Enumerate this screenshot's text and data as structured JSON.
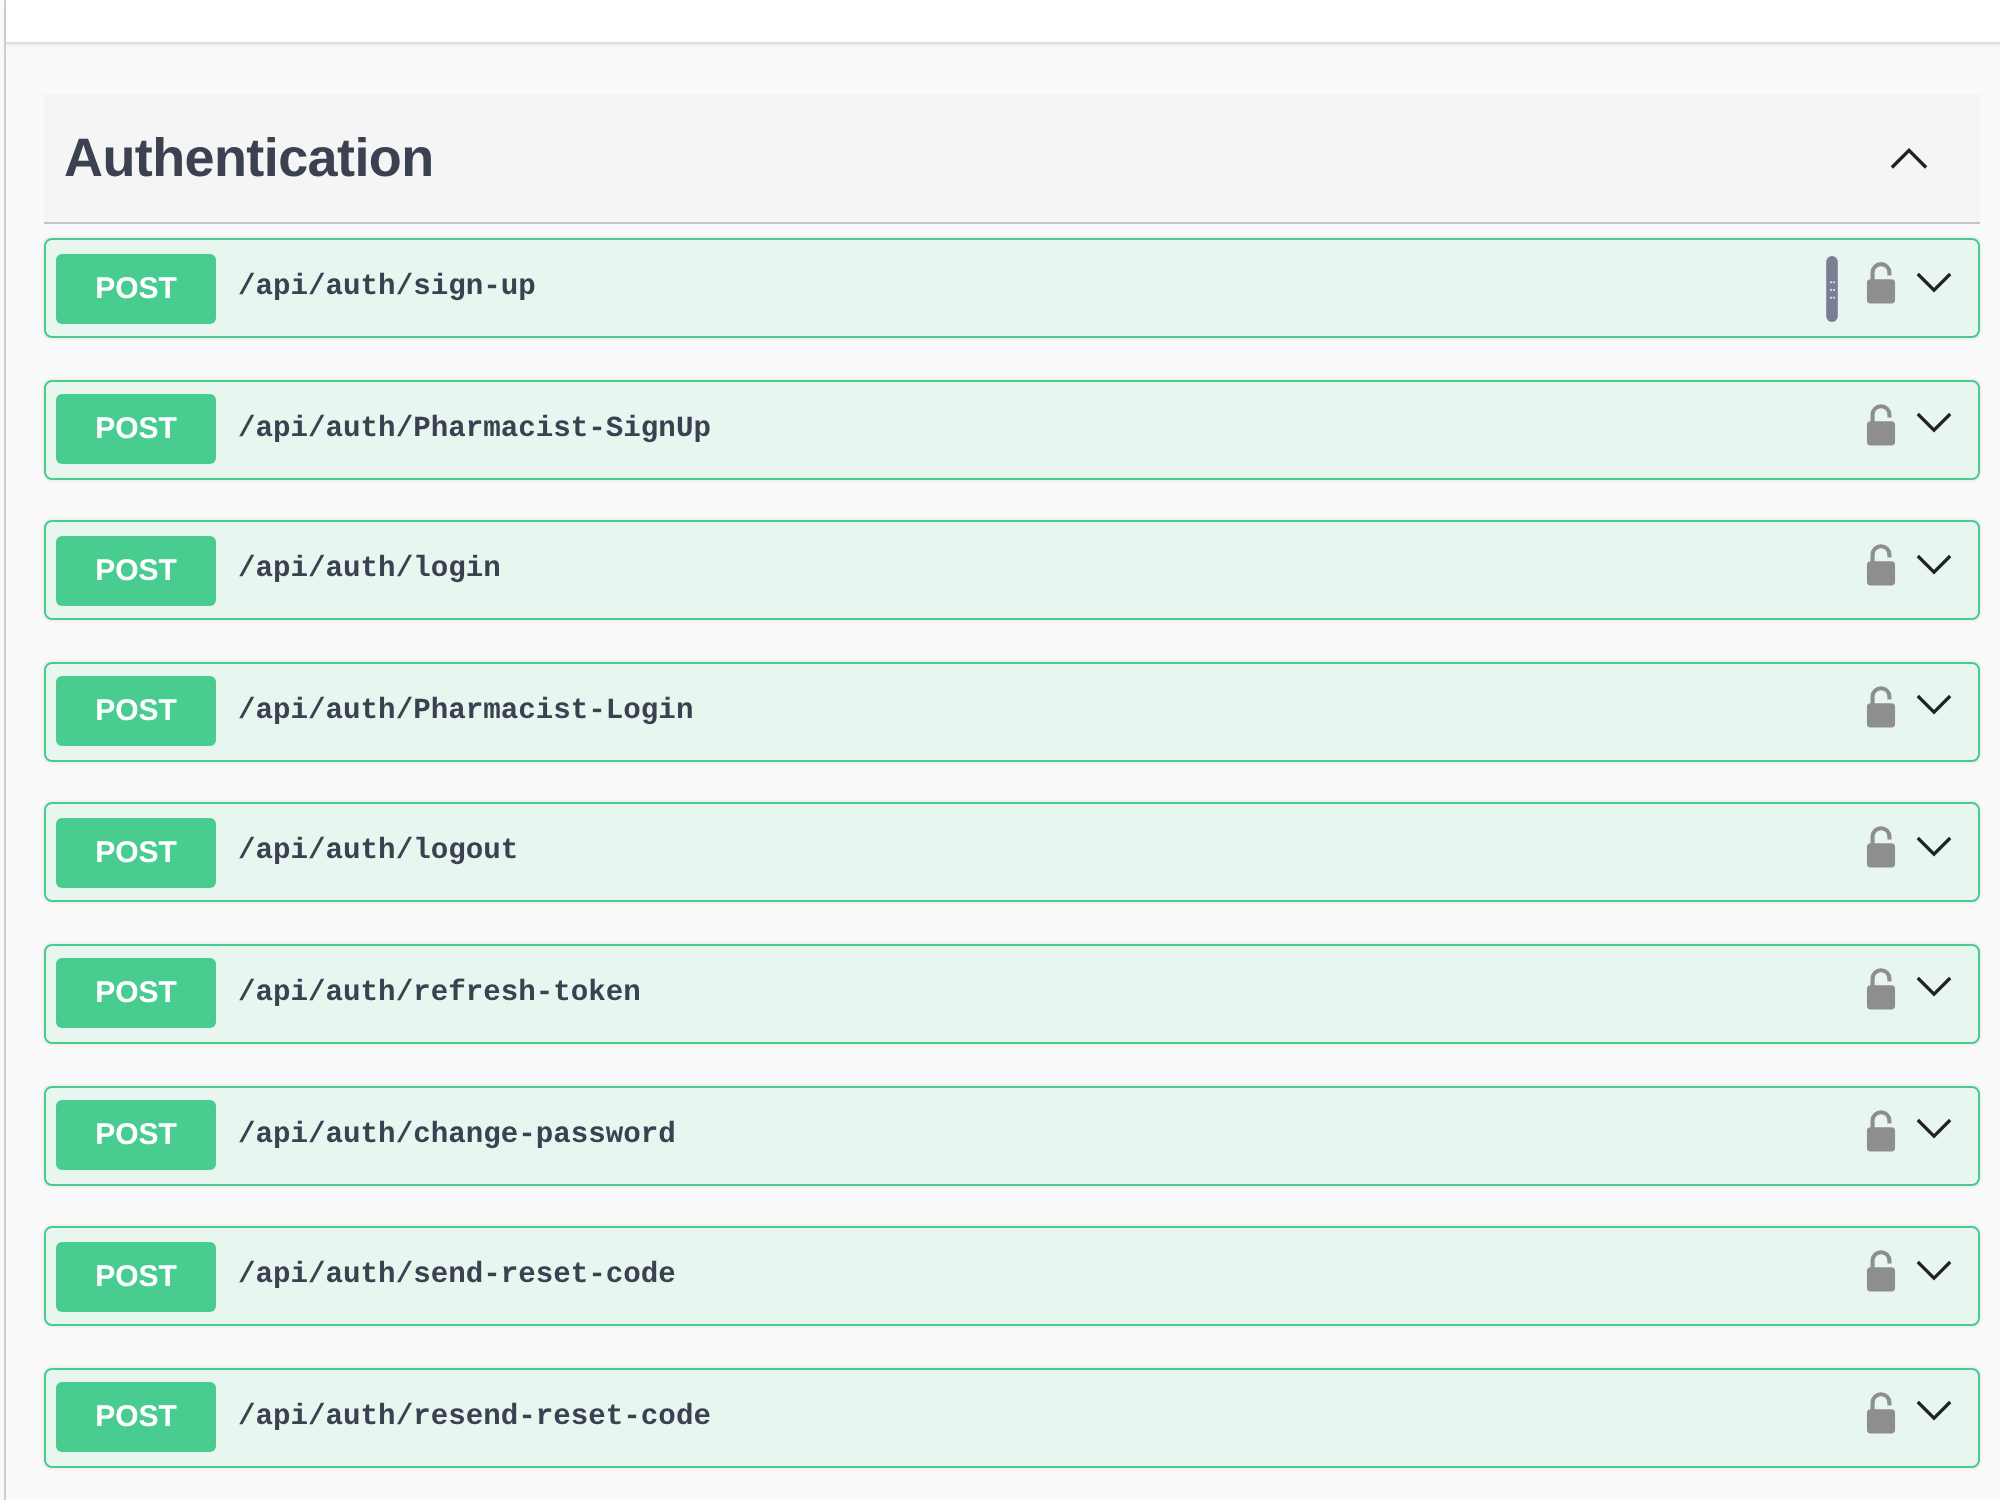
{
  "section": {
    "title": "Authentication",
    "expanded": true
  },
  "operations": [
    {
      "method": "POST",
      "path": "/api/auth/sign-up",
      "grip": true,
      "locked": false,
      "expanded": false
    },
    {
      "method": "POST",
      "path": "/api/auth/Pharmacist-SignUp",
      "grip": false,
      "locked": false,
      "expanded": false
    },
    {
      "method": "POST",
      "path": "/api/auth/login",
      "grip": false,
      "locked": false,
      "expanded": false
    },
    {
      "method": "POST",
      "path": "/api/auth/Pharmacist-Login",
      "grip": false,
      "locked": false,
      "expanded": false
    },
    {
      "method": "POST",
      "path": "/api/auth/logout",
      "grip": false,
      "locked": false,
      "expanded": false
    },
    {
      "method": "POST",
      "path": "/api/auth/refresh-token",
      "grip": false,
      "locked": false,
      "expanded": false
    },
    {
      "method": "POST",
      "path": "/api/auth/change-password",
      "grip": false,
      "locked": false,
      "expanded": false
    },
    {
      "method": "POST",
      "path": "/api/auth/send-reset-code",
      "grip": false,
      "locked": false,
      "expanded": false
    },
    {
      "method": "POST",
      "path": "/api/auth/resend-reset-code",
      "grip": false,
      "locked": false,
      "expanded": false
    }
  ]
}
